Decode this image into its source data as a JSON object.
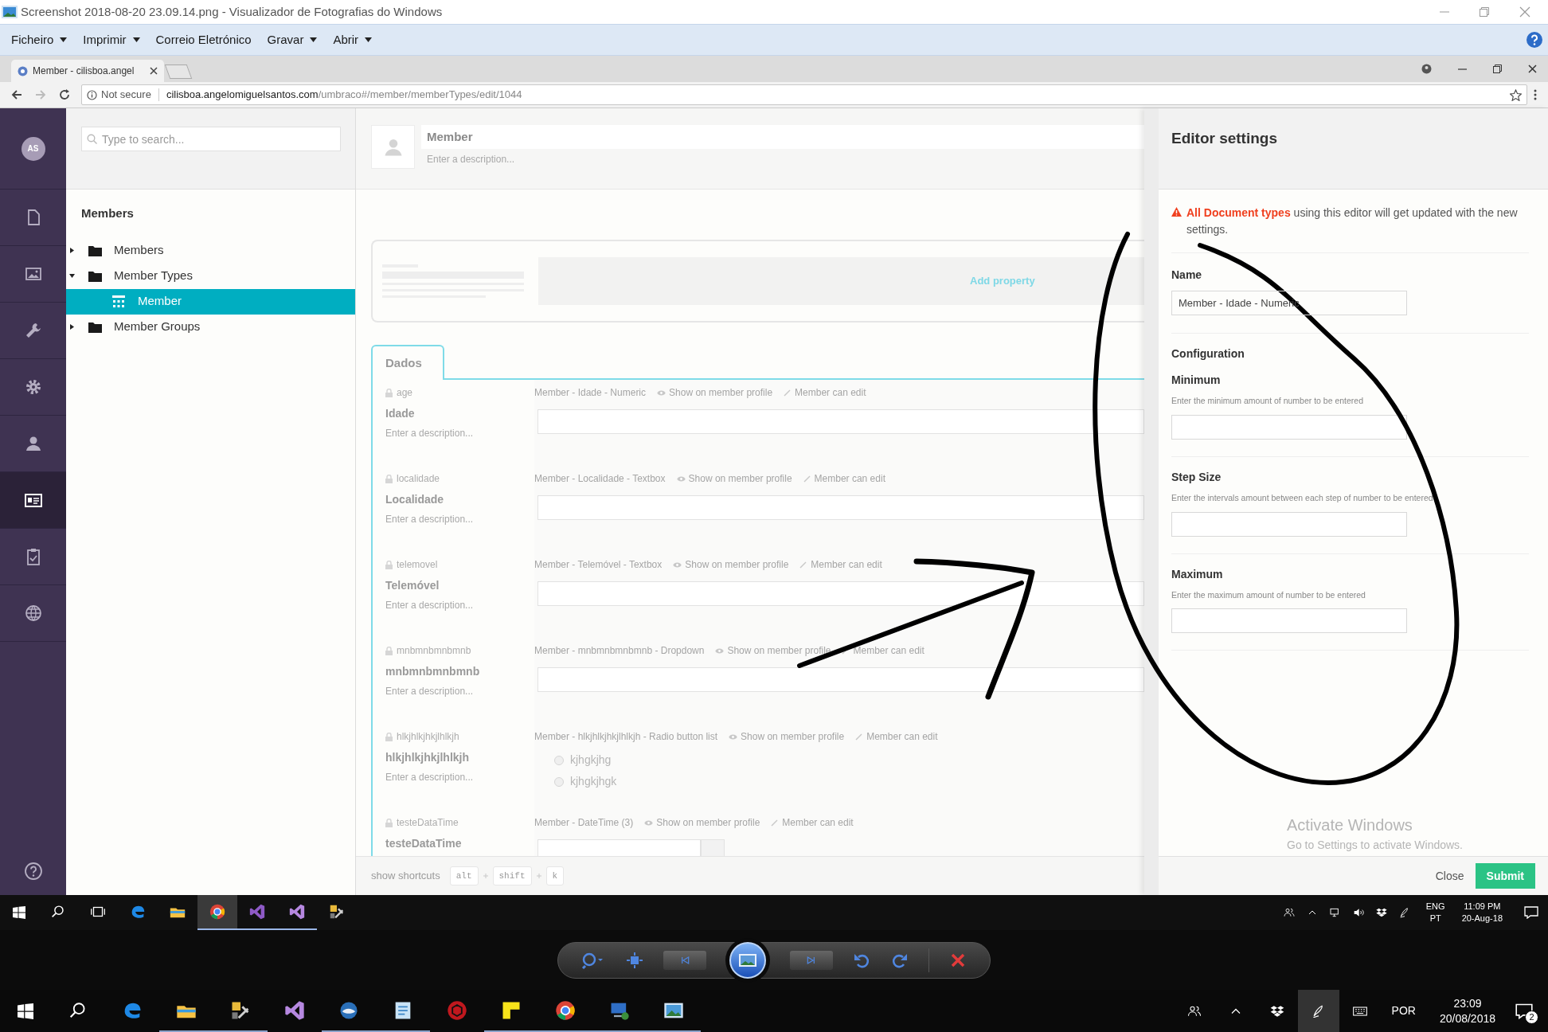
{
  "viewer": {
    "title": "Screenshot 2018-08-20 23.09.14.png - Visualizador de Fotografias do Windows",
    "menu": [
      {
        "label": "Ficheiro",
        "dropdown": true
      },
      {
        "label": "Imprimir",
        "dropdown": true
      },
      {
        "label": "Correio Eletrónico",
        "dropdown": false
      },
      {
        "label": "Gravar",
        "dropdown": true
      },
      {
        "label": "Abrir",
        "dropdown": true
      }
    ]
  },
  "browser": {
    "tab_title": "Member - cilisboa.angel",
    "security": "Not secure",
    "url_host": "cilisboa.angelomiguelsantos.com",
    "url_path": "/umbraco#/member/memberTypes/edit/1044"
  },
  "app": {
    "avatar": "AS",
    "sections": [
      {
        "kind": "document",
        "selected": false
      },
      {
        "kind": "picture",
        "selected": false
      },
      {
        "kind": "wrench",
        "selected": false
      },
      {
        "kind": "gear",
        "selected": false
      },
      {
        "kind": "user",
        "selected": false
      },
      {
        "kind": "idcard",
        "selected": true
      },
      {
        "kind": "clipboard",
        "selected": false
      },
      {
        "kind": "globe",
        "selected": false
      }
    ]
  },
  "tree": {
    "search_placeholder": "Type to search...",
    "heading": "Members",
    "items": [
      {
        "label": "Members",
        "kind": "folder",
        "expanded": false,
        "selected": false
      },
      {
        "label": "Member Types",
        "kind": "folder",
        "expanded": true,
        "selected": false,
        "children": [
          {
            "label": "Member",
            "kind": "doctype",
            "selected": true
          }
        ]
      },
      {
        "label": "Member Groups",
        "kind": "folder",
        "expanded": false,
        "selected": false
      }
    ]
  },
  "editor": {
    "name": "Member",
    "description_placeholder": "Enter a description...",
    "add_property": "Add property",
    "tabs": [
      {
        "label": "Dados",
        "selected": true
      }
    ],
    "properties": [
      {
        "kind": "input",
        "alias": "age",
        "name": "Idade",
        "description_placeholder": "Enter a description...",
        "editor": "Member - Idade - Numeric",
        "show_on_profile": "Show on member profile",
        "can_edit": "Member can edit"
      },
      {
        "kind": "input",
        "alias": "localidade",
        "name": "Localidade",
        "description_placeholder": "Enter a description...",
        "editor": "Member - Localidade - Textbox",
        "show_on_profile": "Show on member profile",
        "can_edit": "Member can edit"
      },
      {
        "kind": "input",
        "alias": "telemovel",
        "name": "Telemóvel",
        "description_placeholder": "Enter a description...",
        "editor": "Member - Telemóvel - Textbox",
        "show_on_profile": "Show on member profile",
        "can_edit": "Member can edit"
      },
      {
        "kind": "input",
        "alias": "mnbmnbmnbmnb",
        "name": "mnbmnbmnbmnb",
        "description_placeholder": "Enter a description...",
        "editor": "Member - mnbmnbmnbmnb - Dropdown",
        "show_on_profile": "Show on member profile",
        "can_edit": "Member can edit"
      },
      {
        "kind": "radio",
        "alias": "hlkjhlkjhkjlhlkjh",
        "name": "hlkjhlkjhkjlhlkjh",
        "description_placeholder": "Enter a description...",
        "editor": "Member - hlkjhlkjhkjlhlkjh - Radio button list",
        "show_on_profile": "Show on member profile",
        "can_edit": "Member can edit",
        "options": [
          {
            "label": "kjhgkjhg",
            "checked": false
          },
          {
            "label": "kjhgkjhgk",
            "checked": false
          }
        ]
      },
      {
        "kind": "date",
        "alias": "testeDataTime",
        "name": "testeDataTime",
        "editor": "Member - DateTime (3)",
        "show_on_profile": "Show on member profile",
        "can_edit": "Member can edit"
      }
    ],
    "shortcuts": {
      "label": "show shortcuts",
      "keys": [
        "alt",
        "shift",
        "k"
      ]
    }
  },
  "settings": {
    "title": "Editor settings",
    "warning_link": "All Document types",
    "warning_text": "using this editor will get updated with the new settings.",
    "name_label": "Name",
    "name_value": "Member - Idade - Numeric",
    "config_heading": "Configuration",
    "fields": [
      {
        "label": "Minimum",
        "hint": "Enter the minimum amount of number to be entered"
      },
      {
        "label": "Step Size",
        "hint": "Enter the intervals amount between each step of number to be entered"
      },
      {
        "label": "Maximum",
        "hint": "Enter the maximum amount of number to be entered"
      }
    ],
    "close": "Close",
    "submit": "Submit"
  },
  "activation": {
    "title": "Activate Windows",
    "subtitle": "Go to Settings to activate Windows."
  },
  "inner_taskbar": {
    "apps": [
      {
        "kind": "search",
        "running": false,
        "active": false
      },
      {
        "kind": "taskview",
        "running": false,
        "active": false
      },
      {
        "kind": "edge",
        "running": false,
        "active": false
      },
      {
        "kind": "explorer",
        "running": false,
        "active": false
      },
      {
        "kind": "chrome",
        "running": true,
        "active": true
      },
      {
        "kind": "vsdark",
        "running": true,
        "active": false
      },
      {
        "kind": "vs",
        "running": true,
        "active": false
      },
      {
        "kind": "tools",
        "running": false,
        "active": false
      }
    ],
    "tray": [
      {
        "kind": "people"
      },
      {
        "kind": "caret"
      },
      {
        "kind": "network"
      },
      {
        "kind": "volume"
      },
      {
        "kind": "dropbox"
      },
      {
        "kind": "pen"
      }
    ],
    "lang": "ENG",
    "lang2": "PT",
    "time": "11:09 PM",
    "date": "20-Aug-18"
  },
  "viewer_controls": [
    {
      "kind": "zoom"
    },
    {
      "kind": "fit"
    },
    {
      "kind": "prev"
    },
    {
      "kind": "slideshow"
    },
    {
      "kind": "next"
    },
    {
      "kind": "rotateleft"
    },
    {
      "kind": "rotateright"
    },
    {
      "kind": "delete"
    }
  ],
  "outer_taskbar": {
    "apps": [
      {
        "kind": "search",
        "running": false,
        "active": false
      },
      {
        "kind": "edge",
        "running": false,
        "active": false
      },
      {
        "kind": "explorer",
        "running": true,
        "active": false
      },
      {
        "kind": "tools",
        "running": true,
        "active": false
      },
      {
        "kind": "vs",
        "running": false,
        "active": false
      },
      {
        "kind": "mail",
        "running": true,
        "active": false
      },
      {
        "kind": "notes",
        "running": true,
        "active": false
      },
      {
        "kind": "red",
        "running": false,
        "active": false
      },
      {
        "kind": "sticky",
        "running": true,
        "active": false
      },
      {
        "kind": "chrome",
        "running": true,
        "active": false
      },
      {
        "kind": "pc",
        "running": true,
        "active": false
      },
      {
        "kind": "photo",
        "running": true,
        "active": false
      }
    ],
    "tray": [
      {
        "kind": "people",
        "selected": false
      },
      {
        "kind": "caret",
        "selected": false
      },
      {
        "kind": "dropbox",
        "selected": false
      },
      {
        "kind": "pen",
        "selected": true
      },
      {
        "kind": "keyboard",
        "selected": false
      }
    ],
    "lang": "POR",
    "time": "23:09",
    "date": "20/08/2018",
    "notifications": "2"
  }
}
